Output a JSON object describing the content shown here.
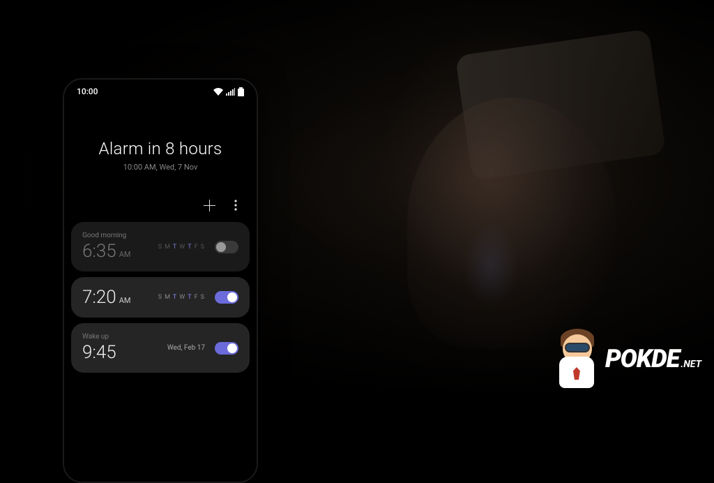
{
  "status_bar": {
    "time": "10:00",
    "icons": [
      "wifi",
      "signal",
      "battery"
    ]
  },
  "header": {
    "title": "Alarm in 8 hours",
    "subtitle": "10:00 AM, Wed, 7 Nov"
  },
  "actions": {
    "add": "+",
    "menu": "⋮"
  },
  "alarms": [
    {
      "label": "Good morning",
      "time": "6:35",
      "ampm": "AM",
      "days": [
        "S",
        "M",
        "T",
        "W",
        "T",
        "F",
        "S"
      ],
      "selected_days": [
        2,
        4
      ],
      "enabled": false,
      "show_days": true
    },
    {
      "label": "",
      "time": "7:20",
      "ampm": "AM",
      "days": [
        "S",
        "M",
        "T",
        "W",
        "T",
        "F",
        "S"
      ],
      "selected_days": [
        2,
        4
      ],
      "enabled": true,
      "show_days": true
    },
    {
      "label": "Wake up",
      "time": "9:45",
      "ampm": "",
      "date_text": "Wed, Feb 17",
      "enabled": true,
      "show_days": false
    }
  ],
  "branding": {
    "logo_main": "POKDE",
    "logo_ext": ".NET"
  }
}
